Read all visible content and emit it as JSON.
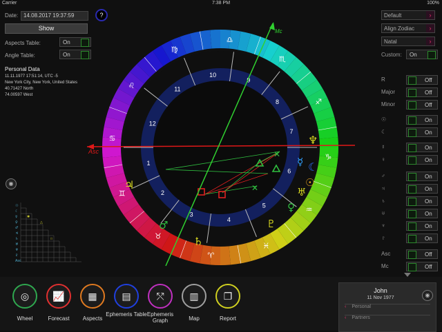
{
  "status": {
    "carrier": "Carrier",
    "time": "7:38 PM",
    "battery": "100%"
  },
  "left": {
    "date_label": "Date:",
    "date_value": "14.08.2017 19:37:59",
    "show_button": "Show",
    "aspects_table_label": "Aspects Table:",
    "aspects_table_value": "On",
    "angle_table_label": "Angle Table:",
    "angle_table_value": "On",
    "personal_title": "Personal Data",
    "personal_line1": "11.11.1977 17:51:14, UTC -5",
    "personal_line2": "New York City, New York, United States",
    "personal_line3": "40.71427 North",
    "personal_line4": "74.00597 West"
  },
  "help": "?",
  "chart": {
    "asc_label": "Asc",
    "mc_label": "Mc",
    "houses": [
      "1",
      "2",
      "3",
      "4",
      "5",
      "6",
      "7",
      "8",
      "9",
      "10",
      "11",
      "12"
    ]
  },
  "right": {
    "select1": "Default",
    "select2": "Align Zodiac",
    "select3": "Natal",
    "custom_label": "Custom:",
    "custom_value": "On",
    "toggles": [
      {
        "label": "R",
        "value": "Off"
      },
      {
        "label": "Major",
        "value": "Off"
      },
      {
        "label": "Minor",
        "value": "Off"
      },
      {
        "label": "☉",
        "value": "On"
      },
      {
        "label": "☾",
        "value": "On"
      },
      {
        "label": "☿",
        "value": "On"
      },
      {
        "label": "♀",
        "value": "On"
      },
      {
        "label": "♂",
        "value": "On"
      },
      {
        "label": "♃",
        "value": "On"
      },
      {
        "label": "♄",
        "value": "On"
      },
      {
        "label": "♅",
        "value": "On"
      },
      {
        "label": "♆",
        "value": "On"
      },
      {
        "label": "♇",
        "value": "On"
      },
      {
        "label": "Asc",
        "value": "Off"
      },
      {
        "label": "Mc",
        "value": "Off"
      }
    ]
  },
  "nav": [
    {
      "label": "Wheel",
      "color": "#2fa84f",
      "glyph": "◎"
    },
    {
      "label": "Forecast",
      "color": "#e03030",
      "glyph": "📈"
    },
    {
      "label": "Aspects",
      "color": "#e07a20",
      "glyph": "▦"
    },
    {
      "label": "Ephemeris Table",
      "color": "#2040e0",
      "glyph": "▤"
    },
    {
      "label": "Ephemeris Graph",
      "color": "#c030c0",
      "glyph": "⤲"
    },
    {
      "label": "Map",
      "color": "#a0a0a0",
      "glyph": "▥"
    },
    {
      "label": "Report",
      "color": "#d0d020",
      "glyph": "❐"
    }
  ],
  "profile": {
    "name": "John",
    "date": "11 Nov 1977",
    "personal": "Personal",
    "partners": "Partners"
  }
}
